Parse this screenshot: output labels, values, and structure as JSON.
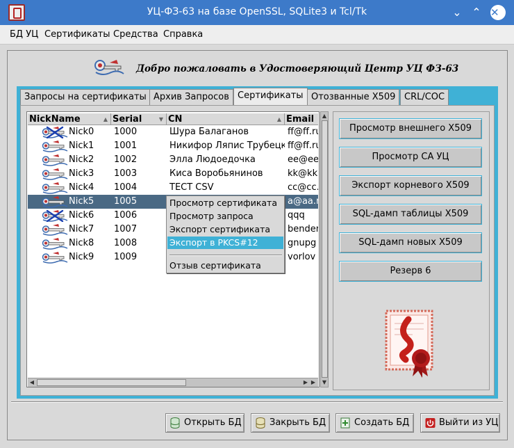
{
  "window": {
    "title": "УЦ-ФЗ-63 на базе OpenSSL, SQLite3 и Tcl/Tk"
  },
  "menu": [
    "БД УЦ",
    "Сертификаты",
    "Средства",
    "Справка"
  ],
  "banner": {
    "welcome": "Добро пожаловать в Удостоверяющий Центр УЦ ФЗ-63"
  },
  "tabs": [
    "Запросы на сертификаты",
    "Архив Запросов",
    "Сертификаты",
    "Отозванные X509",
    "CRL/COC"
  ],
  "active_tab": "Сертификаты",
  "table": {
    "columns": [
      "NickName",
      "Serial",
      "CN",
      "Email"
    ],
    "rows": [
      {
        "nick": "Nick0",
        "serial": "1000",
        "cn": "Шура Балаганов",
        "email": "ff@ff.ru",
        "revoked": true
      },
      {
        "nick": "Nick1",
        "serial": "1001",
        "cn": "Никифор Ляпис Трубецкой",
        "email": "ff@ff.ru",
        "revoked": false
      },
      {
        "nick": "Nick2",
        "serial": "1002",
        "cn": "Элла Людоедочка",
        "email": "ee@ee.ru",
        "revoked": false
      },
      {
        "nick": "Nick3",
        "serial": "1003",
        "cn": "Киса Воробьянинов",
        "email": "kk@kk.ru",
        "revoked": false
      },
      {
        "nick": "Nick4",
        "serial": "1004",
        "cn": "ТЕСТ CSV",
        "email": "cc@cc.ru",
        "revoked": false
      },
      {
        "nick": "Nick5",
        "serial": "1005",
        "cn": "",
        "email": "a@aa.ru",
        "revoked": false,
        "selected": true
      },
      {
        "nick": "Nick6",
        "serial": "1006",
        "cn": "",
        "email": "qqq",
        "revoked": true
      },
      {
        "nick": "Nick7",
        "serial": "1007",
        "cn": "",
        "email": "bender",
        "revoked": false
      },
      {
        "nick": "Nick8",
        "serial": "1008",
        "cn": "",
        "email": "gnupg",
        "revoked": false
      },
      {
        "nick": "Nick9",
        "serial": "1009",
        "cn": "",
        "email": "vorlov",
        "revoked": false
      }
    ]
  },
  "context_menu": {
    "items": [
      "Просмотр сертификата",
      "Просмотр запроса",
      "Экспорт сертификата",
      "Экспорт в PKCS#12",
      "Отзыв сертификата"
    ],
    "highlighted": "Экспорт в PKCS#12"
  },
  "right_buttons": [
    "Просмотр внешнего X509",
    "Просмотр CA УЦ",
    "Экспорт корневого X509",
    "SQL-дамп таблицы X509",
    "SQL-дамп новых X509",
    "Резерв 6"
  ],
  "bottom_buttons": [
    "Открыть БД",
    "Закрыть БД",
    "Создать БД",
    "Выйти из УЦ"
  ],
  "colors": {
    "titlebar": "#3d7ac9",
    "accent": "#3fb1d6",
    "selection": "#4a6984",
    "background": "#d9d9d9"
  },
  "icons": {
    "row_icon": "certificate-key-icon",
    "revoked_overlay": "revoked-cross-icon"
  }
}
